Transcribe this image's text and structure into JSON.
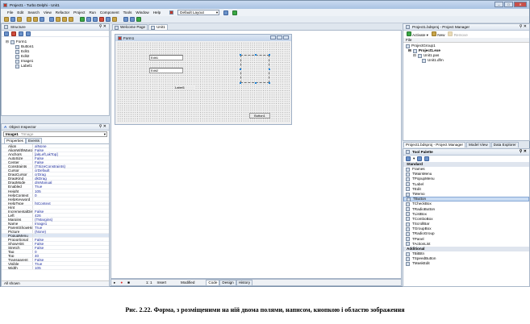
{
  "window": {
    "title": "Project1 - Turbo Delphi - Unit1"
  },
  "menu": [
    "File",
    "Edit",
    "Search",
    "View",
    "Refactor",
    "Project",
    "Run",
    "Component",
    "Tools",
    "Window",
    "Help"
  ],
  "layout_select": "Default Layout",
  "structure": {
    "title": "Structure",
    "root": "Form1",
    "children": [
      "Button1",
      "Edit1",
      "Edit2",
      "Image1",
      "Label1"
    ]
  },
  "inspector": {
    "title": "Object Inspector",
    "object_name": "Image1",
    "object_type": "TImage",
    "tabs": [
      "Properties",
      "Events"
    ],
    "properties": [
      [
        "Align",
        "alNone"
      ],
      [
        "AlignWithMargins",
        "False"
      ],
      [
        "Anchors",
        "[akLeft,akTop]"
      ],
      [
        "AutoSize",
        "False"
      ],
      [
        "Center",
        "False"
      ],
      [
        "Constraints",
        "(TSizeConstraints)"
      ],
      [
        "Cursor",
        "crDefault"
      ],
      [
        "DragCursor",
        "crDrag"
      ],
      [
        "DragKind",
        "dkDrag"
      ],
      [
        "DragMode",
        "dmManual"
      ],
      [
        "Enabled",
        "True"
      ],
      [
        "Height",
        "105"
      ],
      [
        "HelpContext",
        "0"
      ],
      [
        "HelpKeyword",
        ""
      ],
      [
        "HelpType",
        "htContext"
      ],
      [
        "Hint",
        ""
      ],
      [
        "IncrementalDisplay",
        "False"
      ],
      [
        "Left",
        "426"
      ],
      [
        "Margins",
        "(TMargins)"
      ],
      [
        "Name",
        "Image1"
      ],
      [
        "ParentShowHint",
        "True"
      ],
      [
        "Picture",
        "(None)"
      ],
      [
        "PopupMenu",
        ""
      ],
      [
        "Proportional",
        "False"
      ],
      [
        "ShowHint",
        "False"
      ],
      [
        "Stretch",
        "False"
      ],
      [
        "Tag",
        "0"
      ],
      [
        "Top",
        "40"
      ],
      [
        "Transparent",
        "False"
      ],
      [
        "Visible",
        "True"
      ],
      [
        "Width",
        "105"
      ]
    ],
    "status": "All shown"
  },
  "editor_tabs": [
    "Welcome Page",
    "Unit1"
  ],
  "form": {
    "title": "Form1",
    "edit1": "Edit1",
    "edit2": "Edit2",
    "label1": "Label1",
    "button1": "Button1"
  },
  "statusbar": {
    "position": "1:  1",
    "mode": "Insert",
    "state": "Modified",
    "tabs": [
      "Code",
      "Design",
      "History"
    ]
  },
  "project_manager": {
    "title": "Project1.bdsproj - Project Manager",
    "activate": "Activate",
    "new": "New",
    "remove": "Remove",
    "column": "File",
    "items": [
      "ProjectGroup1",
      "Project1.exe",
      "Unit1.pas",
      "Unit1.dfm"
    ]
  },
  "right_tabs": [
    "Project1.bdsproj - Project Manager",
    "Model View",
    "Data Explorer"
  ],
  "palette": {
    "title": "Tool Palette",
    "categories": [
      {
        "name": "Standard",
        "items": [
          "Frames",
          "TMainMenu",
          "TPopupMenu",
          "TLabel",
          "TEdit",
          "TMemo",
          "TButton",
          "TCheckBox",
          "TRadioButton",
          "TListBox",
          "TComboBox",
          "TScrollBar",
          "TGroupBox",
          "TRadioGroup",
          "TPanel",
          "TActionList"
        ]
      },
      {
        "name": "Additional",
        "items": [
          "TBitBtn",
          "TSpeedButton",
          "TMaskEdit"
        ]
      }
    ],
    "selected": "TButton"
  },
  "caption": "Рис. 2.22. Форма, з розміщеними на ній двома полями, написом, кнопкою і областю зображення"
}
